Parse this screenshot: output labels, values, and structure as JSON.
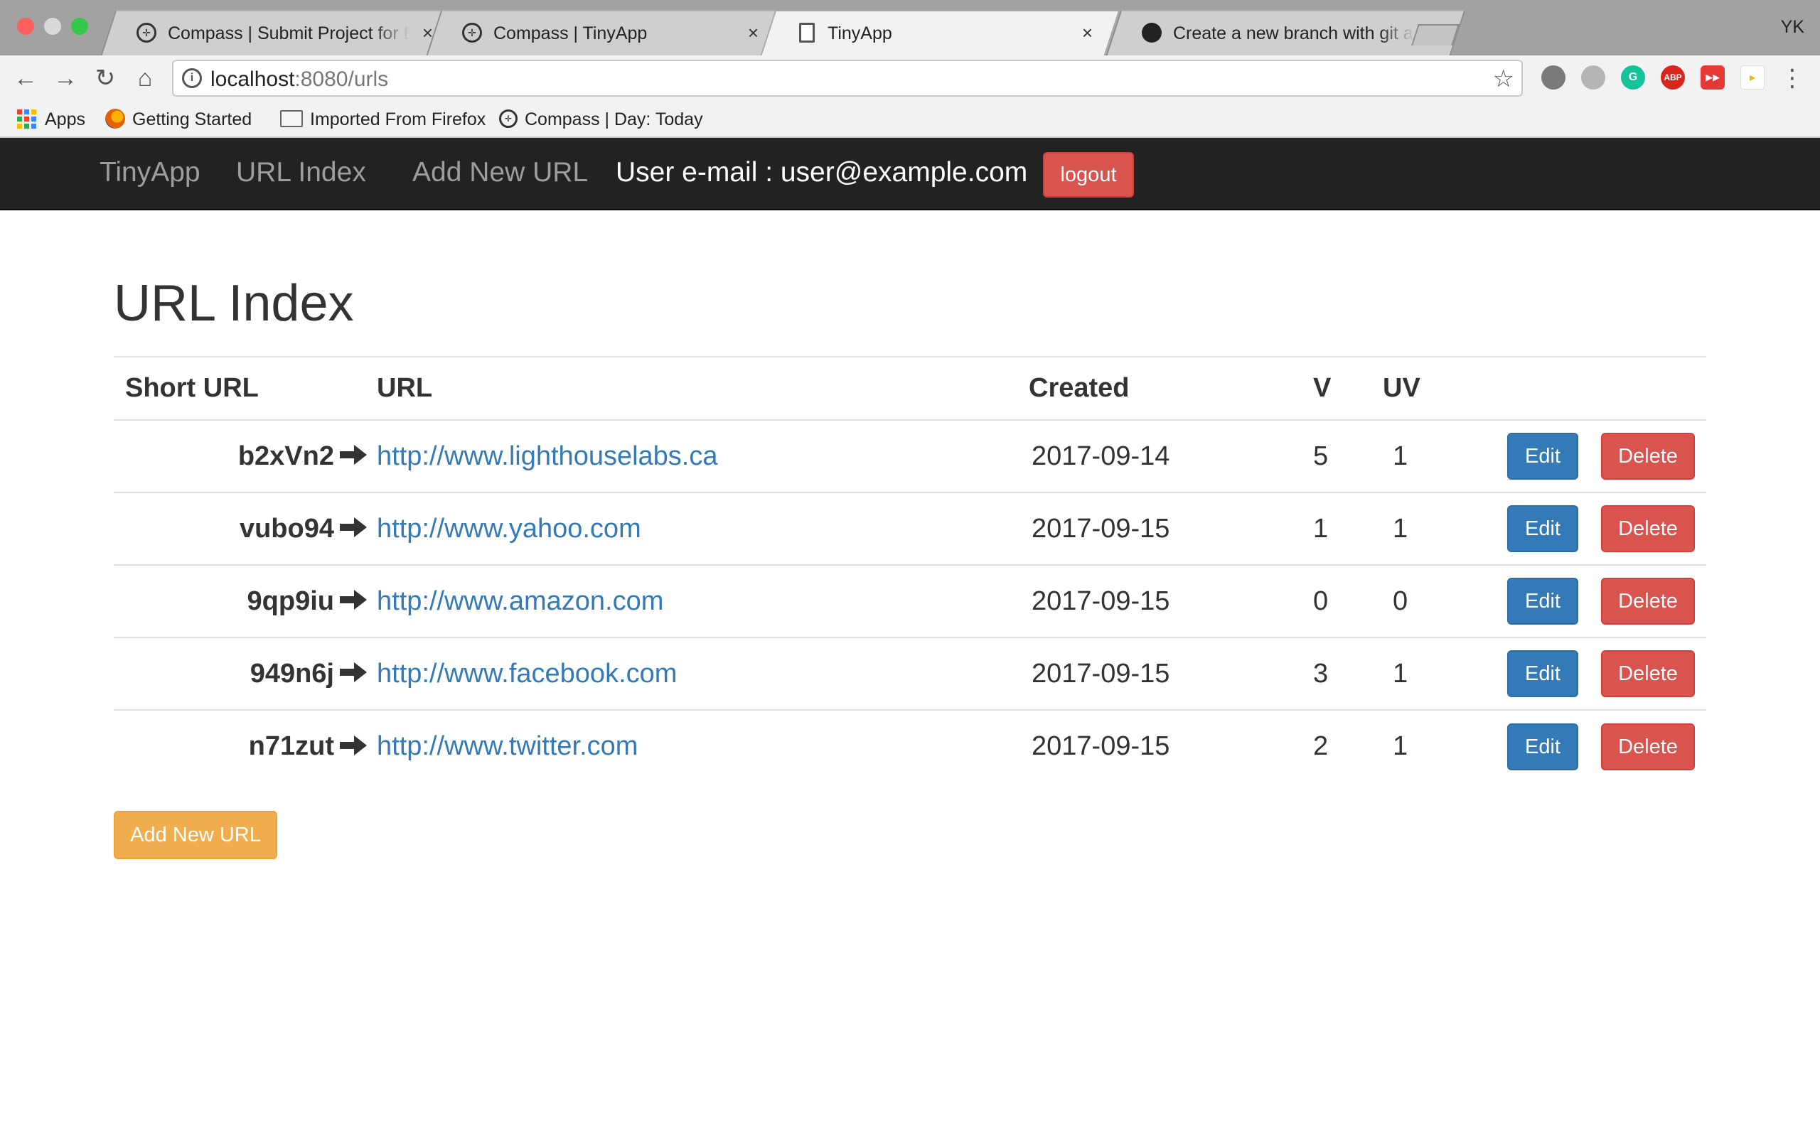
{
  "browser": {
    "tabs": [
      {
        "title": "Compass | Submit Project for Evaluation",
        "icon": "compass-icon",
        "active": false
      },
      {
        "title": "Compass | TinyApp",
        "icon": "compass-icon",
        "active": false
      },
      {
        "title": "TinyApp",
        "icon": "page-icon",
        "active": true
      },
      {
        "title": "Create a new branch with git and manage branches",
        "icon": "github-icon",
        "active": false
      }
    ],
    "close_glyph": "×",
    "profile": "YK",
    "address": {
      "host": "localhost",
      "path": ":8080/urls"
    },
    "bookmarks": [
      {
        "label": "Apps",
        "icon": "apps-grid-icon"
      },
      {
        "label": "Getting Started",
        "icon": "firefox-icon"
      },
      {
        "label": "Imported From Firefox",
        "icon": "folder-icon"
      },
      {
        "label": "Compass | Day: Today",
        "icon": "compass-icon"
      }
    ],
    "extensions": [
      {
        "name": "film-reel-icon",
        "label": "",
        "color": "#7a7a7a"
      },
      {
        "name": "google-drive-icon",
        "label": "",
        "color": "#b5b5b5"
      },
      {
        "name": "grammarly-icon",
        "label": "G",
        "color": "#15c39a"
      },
      {
        "name": "adblock-plus-icon",
        "label": "ABP",
        "color": "#d8261d"
      },
      {
        "name": "fast-forward-icon",
        "label": "▶▶",
        "color": "#e53935"
      },
      {
        "name": "cast-icon",
        "label": "▸",
        "color": "#f4b400"
      }
    ]
  },
  "navbar": {
    "brand": "TinyApp",
    "links": [
      "URL Index",
      "Add New URL"
    ],
    "user_label": "User e-mail : user@example.com",
    "logout": "logout"
  },
  "main": {
    "title": "URL Index",
    "columns": [
      "Short URL",
      "URL",
      "Created",
      "V",
      "UV"
    ],
    "rows": [
      {
        "short": "b2xVn2",
        "url": "http://www.lighthouselabs.ca",
        "created": "2017-09-14",
        "v": "5",
        "uv": "1"
      },
      {
        "short": "vubo94",
        "url": "http://www.yahoo.com",
        "created": "2017-09-15",
        "v": "1",
        "uv": "1"
      },
      {
        "short": "9qp9iu",
        "url": "http://www.amazon.com",
        "created": "2017-09-15",
        "v": "0",
        "uv": "0"
      },
      {
        "short": "949n6j",
        "url": "http://www.facebook.com",
        "created": "2017-09-15",
        "v": "3",
        "uv": "1"
      },
      {
        "short": "n71zut",
        "url": "http://www.twitter.com",
        "created": "2017-09-15",
        "v": "2",
        "uv": "1"
      }
    ],
    "edit_label": "Edit",
    "delete_label": "Delete",
    "add_button": "Add New URL"
  },
  "colors": {
    "navbar_bg": "#222222",
    "link": "#337ab7",
    "danger": "#d9534f",
    "primary": "#337ab7",
    "warning": "#f0ad4e"
  }
}
